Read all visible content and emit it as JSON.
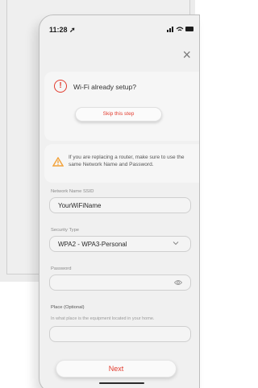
{
  "status_bar": {
    "time": "11:28 ➚",
    "icons": "▐▐ ≋ ▬"
  },
  "close_icon": "×",
  "wifi_card": {
    "title": "Wi-Fi already setup?",
    "skip_label": "Skip this step",
    "alert_glyph": "!"
  },
  "warning_card": {
    "text": "If you are replacing a router, make sure to use the same Network Name and Password."
  },
  "form": {
    "ssid_label": "Network Name SSID",
    "ssid_value": "YourWiFiName",
    "security_label": "Security Type",
    "security_value": "WPA2 - WPA3-Personal",
    "password_label": "Password",
    "password_value": "",
    "place_label": "Place (Optional)",
    "place_hint": "In what place is the equipment located in your home.",
    "place_value": ""
  },
  "next_label": "Next",
  "colors": {
    "accent": "#e23b2e",
    "warning": "#f2a23a"
  }
}
